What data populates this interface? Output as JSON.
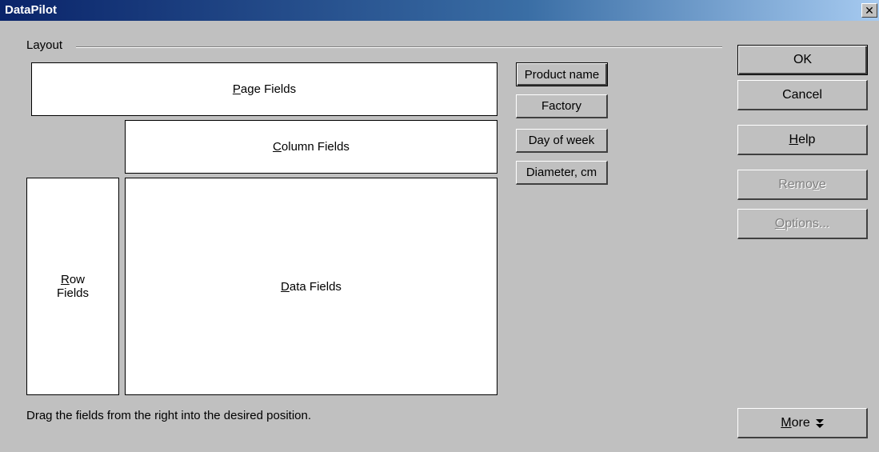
{
  "window": {
    "title": "DataPilot",
    "close_glyph": "✕"
  },
  "layout_group": {
    "label": "Layout"
  },
  "areas": {
    "page_fields": {
      "mnemonic": "P",
      "rest": "age Fields"
    },
    "column_fields": {
      "mnemonic": "C",
      "rest": "olumn Fields"
    },
    "row_fields": {
      "mnemonic": "R",
      "rest_line1": "ow",
      "line2": "Fields"
    },
    "data_fields": {
      "mnemonic": "D",
      "rest": "ata Fields"
    }
  },
  "fields": [
    "Product name",
    "Factory",
    "Day of week",
    "Diameter, cm"
  ],
  "buttons": {
    "ok": "OK",
    "cancel": "Cancel",
    "help": {
      "mnemonic": "H",
      "rest": "elp"
    },
    "remove": {
      "pre": "Remo",
      "mnemonic": "v",
      "rest": "e"
    },
    "options": {
      "mnemonic": "O",
      "rest": "ptions..."
    },
    "more": {
      "mnemonic": "M",
      "rest": "ore",
      "icon": "double-chevron-down-icon",
      "glyph": "▾"
    }
  },
  "hint": "Drag the fields from the right into the desired position."
}
